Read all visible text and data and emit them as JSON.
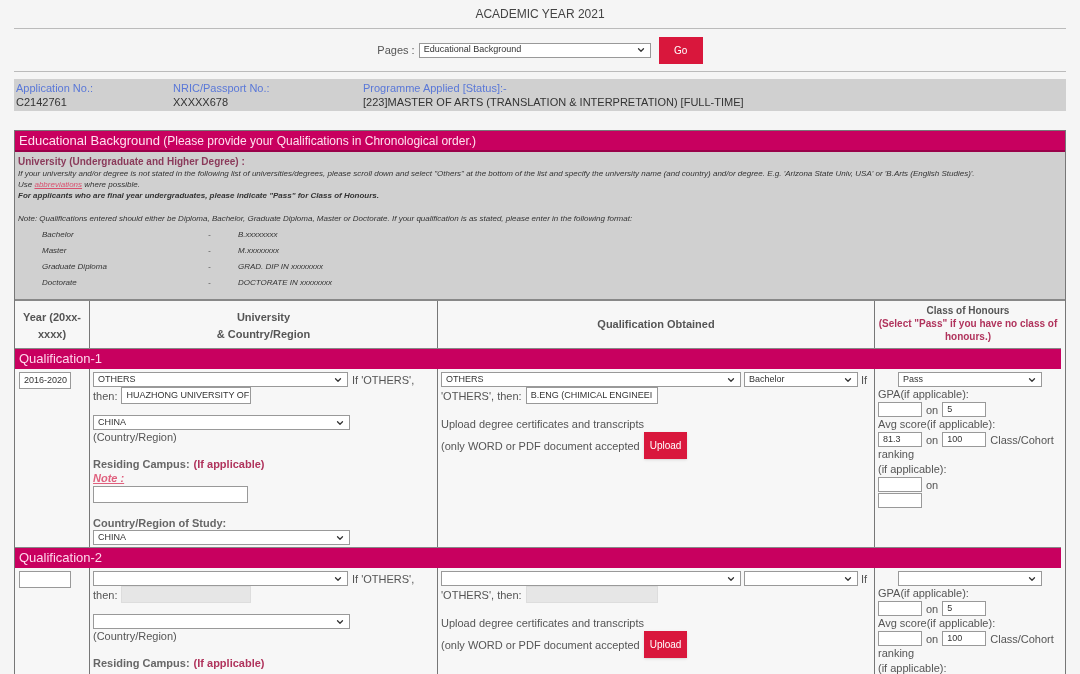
{
  "title": "ACADEMIC YEAR 2021",
  "pages": {
    "label": "Pages :",
    "value": "Educational Background",
    "button": "Go"
  },
  "info": [
    {
      "label": "Application No.:",
      "value": "C2142761"
    },
    {
      "label": "NRIC/Passport No.:",
      "value": "XXXXX678"
    },
    {
      "label": "Programme Applied [Status]:-",
      "value": "[223]MASTER OF ARTS (TRANSLATION & INTERPRETATION) [FULL-TIME]"
    }
  ],
  "section": {
    "title": "Educational Background",
    "subtitle": "(Please provide your Qualifications in Chronological order.)"
  },
  "notice": {
    "heading": "University (Undergraduate and Higher Degree) :",
    "line_1": "If your university and/or degree is not stated in the following list of universities/degrees, please scroll down and select \"Others\" at the bottom of the list and specify the university name (and country) and/or degree. E.g. 'Arizona State Univ, USA' or 'B.Arts (English Studies)'.",
    "line_2_before": "Use ",
    "line_2_link": "abbreviations",
    "line_2_after": " where possible.",
    "line_3": "For applicants who are final year undergraduates, please indicate \"Pass\" for Class of Honours.",
    "note": "Note: Qualifications entered should either be Diploma, Bachelor, Graduate Diploma, Master or Doctorate. If your qualification is as stated, please enter in the following format:",
    "formats": [
      {
        "degree": "Bachelor",
        "separator": "-",
        "format": "B.xxxxxxxx"
      },
      {
        "degree": "Master",
        "separator": "-",
        "format": "M.xxxxxxxx"
      },
      {
        "degree": "Graduate Diploma",
        "separator": "-",
        "format": "GRAD. DIP IN xxxxxxxx"
      },
      {
        "degree": "Doctorate",
        "separator": "-",
        "format": "DOCTORATE IN xxxxxxxx"
      }
    ]
  },
  "columns": {
    "year": "Year (20xx-xxxx)",
    "university": "University",
    "university_2": "& Country/Region",
    "qualification": "Qualification Obtained",
    "honours": "Class of Honours",
    "honours_hint": "(Select \"Pass\" if you have no class of honours.)"
  },
  "qualifications": [
    {
      "label": "Qualification-1",
      "year": "2016-2020",
      "university": "OTHERS",
      "if_others": "If 'OTHERS',",
      "then": "then:",
      "university_other": "HUAZHONG UNIVERSITY OF",
      "other_disabled": false,
      "country": "CHINA",
      "country_region": "(Country/Region)",
      "residing_campus": "Residing Campus:",
      "if_applicable": "(If applicable)",
      "note_link": "Note :",
      "country_of_study_label": "Country/Region of Study:",
      "country_of_study": "CHINA",
      "qualification": "OTHERS",
      "level": "Bachelor",
      "if": "If",
      "others_then": "'OTHERS', then:",
      "qualification_other": "B.ENG (CHIMICAL ENGINEEI",
      "qualification_other_disabled": false,
      "upload_1": "Upload degree certificates and transcripts",
      "upload_2": "(only WORD or PDF document accepted",
      "upload_button": "Upload",
      "honours": "Pass",
      "gpa_label": "GPA(if applicable):",
      "gpa_on_label": "on",
      "gpa_on": "5",
      "avg_label": "Avg score(if applicable):",
      "avg_on_label": "on",
      "avg": "81.3",
      "avg_on": "100",
      "class_cohort": "Class/Cohort",
      "ranking": "ranking",
      "ranking_hint": "(if applicable):",
      "ranking_on_label": "on"
    },
    {
      "label": "Qualification-2",
      "if_others": "If 'OTHERS',",
      "then": "then:",
      "other_disabled": true,
      "country_region": "(Country/Region)",
      "residing_campus": "Residing Campus:",
      "if_applicable": "(If applicable)",
      "if": "If",
      "others_then": "'OTHERS', then:",
      "qualification_other_disabled": true,
      "upload_1": "Upload degree certificates and transcripts",
      "upload_2": "(only WORD or PDF document accepted",
      "upload_button": "Upload",
      "gpa_label": "GPA(if applicable):",
      "gpa_on_label": "on",
      "gpa_on": "5",
      "avg_label": "Avg score(if applicable):",
      "avg_on_label": "on",
      "avg_on": "100",
      "class_cohort": "Class/Cohort",
      "ranking": "ranking",
      "ranking_hint": "(if applicable):"
    }
  ]
}
